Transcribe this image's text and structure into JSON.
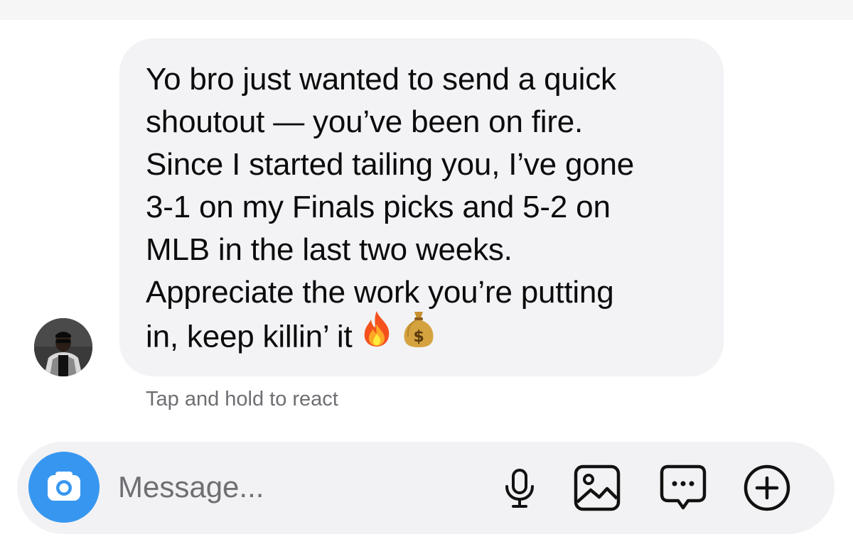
{
  "conversation": {
    "message": {
      "lines": [
        "Yo bro just wanted to send a quick",
        "shoutout — you’ve been on fire.",
        "Since I started tailing you, I’ve gone",
        "3-1 on my Finals picks and 5-2 on",
        "MLB in the last two weeks.",
        "Appreciate the work you’re putting",
        "in, keep killin’ it"
      ],
      "emojis": [
        "fire-emoji",
        "money-bag-emoji"
      ]
    },
    "react_hint": "Tap and hold to react"
  },
  "composer": {
    "placeholder": "Message...",
    "icons": [
      "camera-icon",
      "microphone-icon",
      "gallery-icon",
      "sticker-icon",
      "plus-icon"
    ],
    "accent_color": "#3797f0"
  }
}
